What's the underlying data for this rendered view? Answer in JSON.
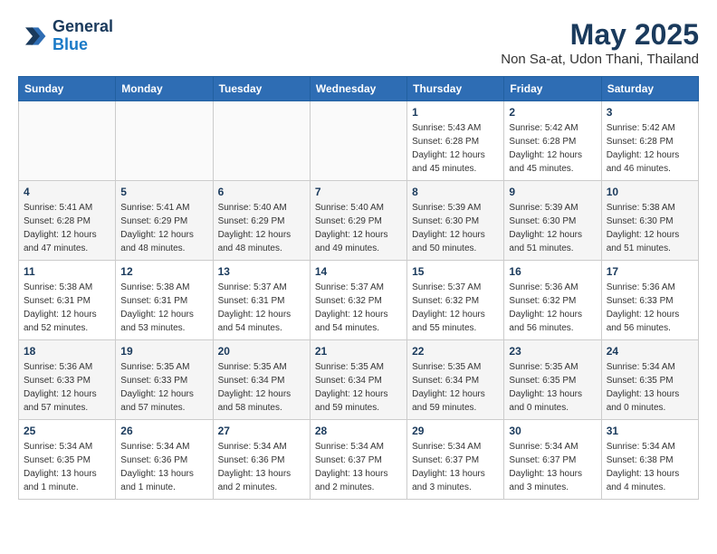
{
  "header": {
    "logo_line1": "General",
    "logo_line2": "Blue",
    "month": "May 2025",
    "location": "Non Sa-at, Udon Thani, Thailand"
  },
  "weekdays": [
    "Sunday",
    "Monday",
    "Tuesday",
    "Wednesday",
    "Thursday",
    "Friday",
    "Saturday"
  ],
  "weeks": [
    [
      {
        "day": "",
        "info": ""
      },
      {
        "day": "",
        "info": ""
      },
      {
        "day": "",
        "info": ""
      },
      {
        "day": "",
        "info": ""
      },
      {
        "day": "1",
        "info": "Sunrise: 5:43 AM\nSunset: 6:28 PM\nDaylight: 12 hours\nand 45 minutes."
      },
      {
        "day": "2",
        "info": "Sunrise: 5:42 AM\nSunset: 6:28 PM\nDaylight: 12 hours\nand 45 minutes."
      },
      {
        "day": "3",
        "info": "Sunrise: 5:42 AM\nSunset: 6:28 PM\nDaylight: 12 hours\nand 46 minutes."
      }
    ],
    [
      {
        "day": "4",
        "info": "Sunrise: 5:41 AM\nSunset: 6:28 PM\nDaylight: 12 hours\nand 47 minutes."
      },
      {
        "day": "5",
        "info": "Sunrise: 5:41 AM\nSunset: 6:29 PM\nDaylight: 12 hours\nand 48 minutes."
      },
      {
        "day": "6",
        "info": "Sunrise: 5:40 AM\nSunset: 6:29 PM\nDaylight: 12 hours\nand 48 minutes."
      },
      {
        "day": "7",
        "info": "Sunrise: 5:40 AM\nSunset: 6:29 PM\nDaylight: 12 hours\nand 49 minutes."
      },
      {
        "day": "8",
        "info": "Sunrise: 5:39 AM\nSunset: 6:30 PM\nDaylight: 12 hours\nand 50 minutes."
      },
      {
        "day": "9",
        "info": "Sunrise: 5:39 AM\nSunset: 6:30 PM\nDaylight: 12 hours\nand 51 minutes."
      },
      {
        "day": "10",
        "info": "Sunrise: 5:38 AM\nSunset: 6:30 PM\nDaylight: 12 hours\nand 51 minutes."
      }
    ],
    [
      {
        "day": "11",
        "info": "Sunrise: 5:38 AM\nSunset: 6:31 PM\nDaylight: 12 hours\nand 52 minutes."
      },
      {
        "day": "12",
        "info": "Sunrise: 5:38 AM\nSunset: 6:31 PM\nDaylight: 12 hours\nand 53 minutes."
      },
      {
        "day": "13",
        "info": "Sunrise: 5:37 AM\nSunset: 6:31 PM\nDaylight: 12 hours\nand 54 minutes."
      },
      {
        "day": "14",
        "info": "Sunrise: 5:37 AM\nSunset: 6:32 PM\nDaylight: 12 hours\nand 54 minutes."
      },
      {
        "day": "15",
        "info": "Sunrise: 5:37 AM\nSunset: 6:32 PM\nDaylight: 12 hours\nand 55 minutes."
      },
      {
        "day": "16",
        "info": "Sunrise: 5:36 AM\nSunset: 6:32 PM\nDaylight: 12 hours\nand 56 minutes."
      },
      {
        "day": "17",
        "info": "Sunrise: 5:36 AM\nSunset: 6:33 PM\nDaylight: 12 hours\nand 56 minutes."
      }
    ],
    [
      {
        "day": "18",
        "info": "Sunrise: 5:36 AM\nSunset: 6:33 PM\nDaylight: 12 hours\nand 57 minutes."
      },
      {
        "day": "19",
        "info": "Sunrise: 5:35 AM\nSunset: 6:33 PM\nDaylight: 12 hours\nand 57 minutes."
      },
      {
        "day": "20",
        "info": "Sunrise: 5:35 AM\nSunset: 6:34 PM\nDaylight: 12 hours\nand 58 minutes."
      },
      {
        "day": "21",
        "info": "Sunrise: 5:35 AM\nSunset: 6:34 PM\nDaylight: 12 hours\nand 59 minutes."
      },
      {
        "day": "22",
        "info": "Sunrise: 5:35 AM\nSunset: 6:34 PM\nDaylight: 12 hours\nand 59 minutes."
      },
      {
        "day": "23",
        "info": "Sunrise: 5:35 AM\nSunset: 6:35 PM\nDaylight: 13 hours\nand 0 minutes."
      },
      {
        "day": "24",
        "info": "Sunrise: 5:34 AM\nSunset: 6:35 PM\nDaylight: 13 hours\nand 0 minutes."
      }
    ],
    [
      {
        "day": "25",
        "info": "Sunrise: 5:34 AM\nSunset: 6:35 PM\nDaylight: 13 hours\nand 1 minute."
      },
      {
        "day": "26",
        "info": "Sunrise: 5:34 AM\nSunset: 6:36 PM\nDaylight: 13 hours\nand 1 minute."
      },
      {
        "day": "27",
        "info": "Sunrise: 5:34 AM\nSunset: 6:36 PM\nDaylight: 13 hours\nand 2 minutes."
      },
      {
        "day": "28",
        "info": "Sunrise: 5:34 AM\nSunset: 6:37 PM\nDaylight: 13 hours\nand 2 minutes."
      },
      {
        "day": "29",
        "info": "Sunrise: 5:34 AM\nSunset: 6:37 PM\nDaylight: 13 hours\nand 3 minutes."
      },
      {
        "day": "30",
        "info": "Sunrise: 5:34 AM\nSunset: 6:37 PM\nDaylight: 13 hours\nand 3 minutes."
      },
      {
        "day": "31",
        "info": "Sunrise: 5:34 AM\nSunset: 6:38 PM\nDaylight: 13 hours\nand 4 minutes."
      }
    ]
  ]
}
